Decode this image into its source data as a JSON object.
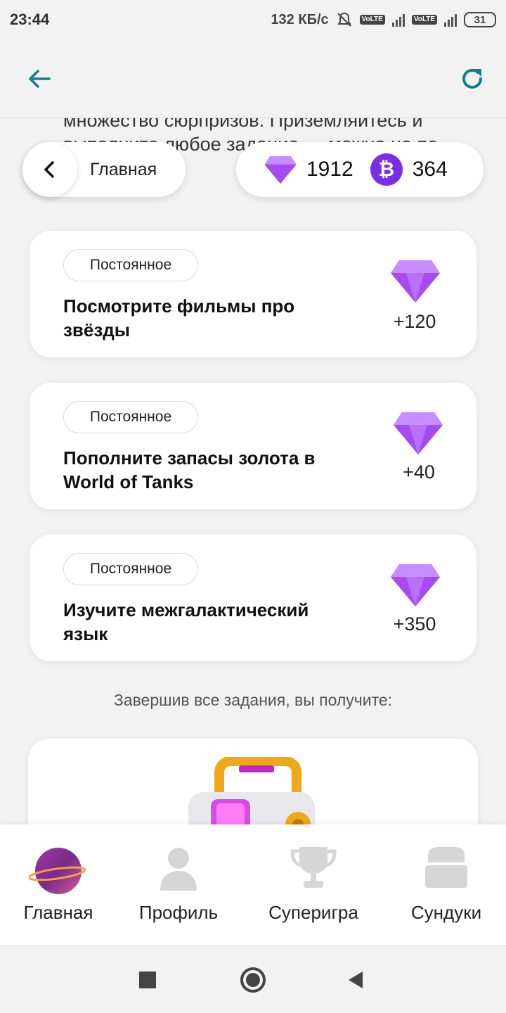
{
  "status_bar": {
    "time": "23:44",
    "network_speed": "132 КБ/с",
    "battery": "31",
    "sim1_label": "Vo LTE",
    "sim2_label": "Vo LTE",
    "net_type": "4G"
  },
  "header": {
    "back_icon": "arrow-left-icon",
    "refresh_icon": "refresh-icon",
    "accent_color": "#0f7f8f"
  },
  "intro": {
    "text": "множество сюрпризов. Приземляйтесь и выполните любое задание — можно не по порядку."
  },
  "breadcrumb": {
    "label": "Главная"
  },
  "balance": {
    "gems": "1912",
    "coins": "364",
    "coin_symbol": "₿",
    "gem_color": "#b55cf5",
    "coin_color": "#7b2ee6"
  },
  "tasks": [
    {
      "badge": "Постоянное",
      "title": "Посмотрите фильмы про звёзды",
      "reward": "+120"
    },
    {
      "badge": "Постоянное",
      "title": "Пополните запасы золота в World of Tanks",
      "reward": "+40"
    },
    {
      "badge": "Постоянное",
      "title": "Изучите межгалактический язык",
      "reward": "+350"
    }
  ],
  "completion": {
    "text": "Завершив все задания, вы получите:"
  },
  "bottom_nav": [
    {
      "label": "Главная",
      "icon": "planet-icon",
      "active": true
    },
    {
      "label": "Профиль",
      "icon": "person-icon",
      "active": false
    },
    {
      "label": "Суперигра",
      "icon": "trophy-icon",
      "active": false
    },
    {
      "label": "Сундуки",
      "icon": "chest-icon",
      "active": false
    }
  ],
  "system_nav": {
    "recent_icon": "square-icon",
    "home_icon": "circle-icon",
    "back_icon": "triangle-back-icon"
  }
}
